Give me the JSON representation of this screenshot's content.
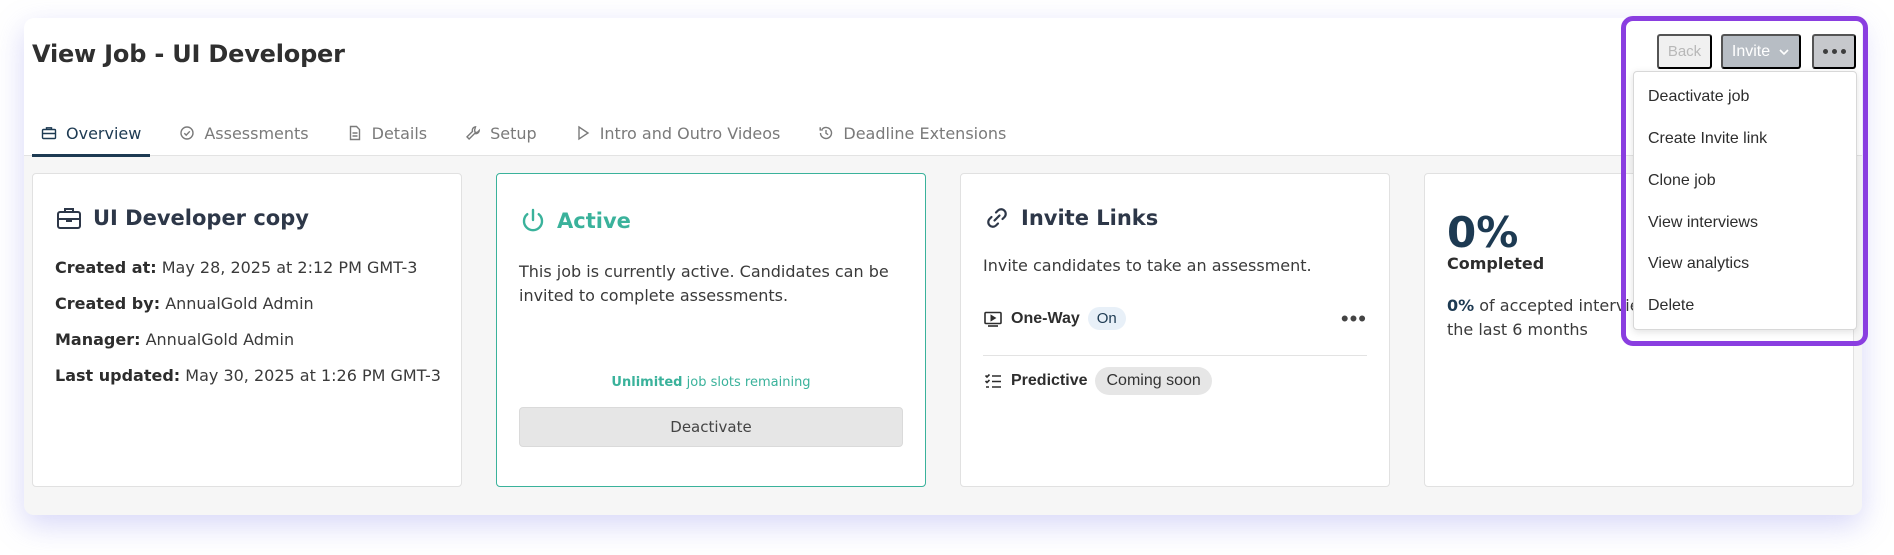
{
  "header": {
    "title": "View Job - UI Developer",
    "tabs": [
      {
        "label": "Overview",
        "icon": "briefcase-icon",
        "active": true
      },
      {
        "label": "Assessments",
        "icon": "check-circle-icon"
      },
      {
        "label": "Details",
        "icon": "document-icon"
      },
      {
        "label": "Setup",
        "icon": "wrench-icon"
      },
      {
        "label": "Intro and Outro Videos",
        "icon": "play-icon"
      },
      {
        "label": "Deadline Extensions",
        "icon": "history-icon"
      }
    ]
  },
  "actions": {
    "back_label": "Back",
    "invite_label": "Invite",
    "more_icon": "ellipsis-icon"
  },
  "dropdown": {
    "items": [
      "Deactivate job",
      "Create Invite link",
      "Clone job",
      "View interviews",
      "View analytics",
      "Delete"
    ]
  },
  "job_card": {
    "title": "UI Developer copy",
    "icon": "briefcase-icon",
    "created_at_label": "Created at:",
    "created_at": "May 28, 2025 at 2:12 PM GMT-3",
    "created_by_label": "Created by:",
    "created_by": "AnnualGold Admin",
    "manager_label": "Manager:",
    "manager": "AnnualGold Admin",
    "updated_label": "Last updated:",
    "updated": "May 30, 2025 at 1:26 PM GMT-3"
  },
  "status_card": {
    "title": "Active",
    "icon": "power-icon",
    "description": "This job is currently active. Candidates can be invited to complete assessments.",
    "slots_strong": "Unlimited",
    "slots_text": "job slots remaining",
    "button_label": "Deactivate",
    "accent": "#3ab29b"
  },
  "invite_card": {
    "title": "Invite Links",
    "icon": "link-icon",
    "description": "Invite candidates to take an assessment.",
    "rows": [
      {
        "label": "One-Way",
        "badge": "On",
        "icon": "video-icon"
      },
      {
        "label": "Predictive",
        "badge": "Coming soon",
        "icon": "checklist-icon"
      }
    ]
  },
  "completion_card": {
    "value": "0%",
    "label": "Completed",
    "desc_strong": "0%",
    "desc_line1": "of accepted intervie",
    "desc_line2": "the last 6 months"
  }
}
